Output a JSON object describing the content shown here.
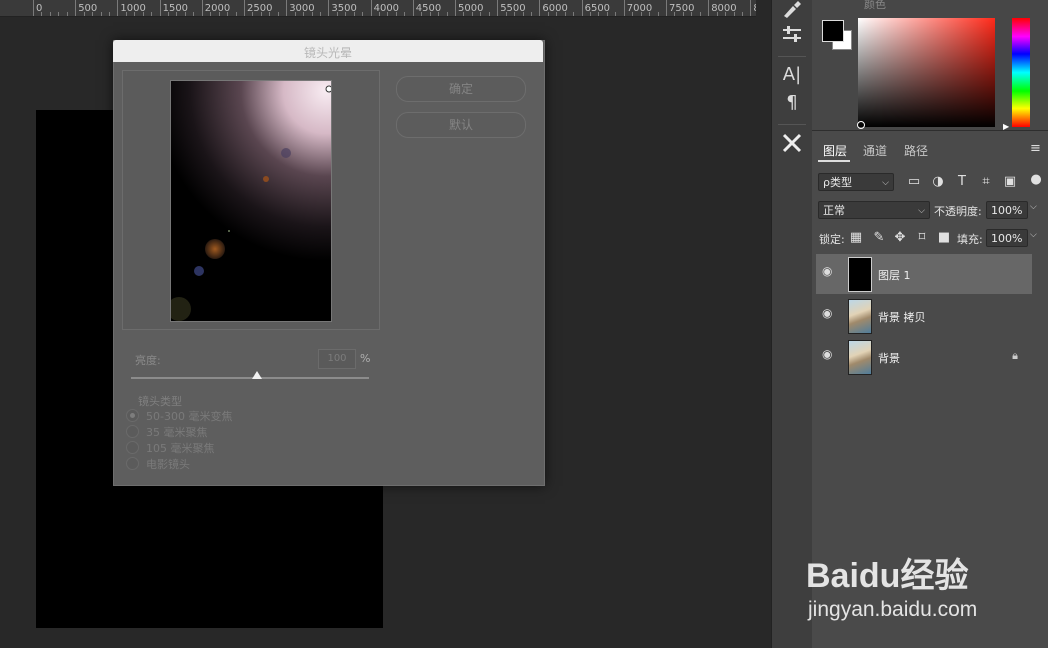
{
  "ruler": {
    "labels": [
      "0",
      "500",
      "1000",
      "1500",
      "2000",
      "2500",
      "3000",
      "3500",
      "4000",
      "4500",
      "5000",
      "5500",
      "6000",
      "6500",
      "7000",
      "7500",
      "8000",
      "8"
    ]
  },
  "toolbar": {
    "icons": [
      "brush-settings-icon",
      "adjust-sliders-icon",
      "character-icon",
      "paragraph-icon",
      "tools-icon"
    ],
    "character_glyph": "A|",
    "paragraph_glyph": "¶"
  },
  "color_panel": {
    "title": "颜色",
    "foreground": "#000000",
    "background": "#ffffff",
    "hue": "#ff2a1a"
  },
  "layers_panel": {
    "tabs": [
      "图层",
      "通道",
      "路径"
    ],
    "filter_label": "ρ类型",
    "blend_mode": "正常",
    "opacity_label": "不透明度:",
    "opacity_value": "100%",
    "lock_label": "锁定:",
    "fill_label": "填充:",
    "fill_value": "100%",
    "layers": [
      {
        "name": "图层 1",
        "thumb": "black",
        "active": true,
        "locked": false
      },
      {
        "name": "背景 拷贝",
        "thumb": "photo",
        "active": false,
        "locked": false
      },
      {
        "name": "背景",
        "thumb": "photo",
        "active": false,
        "locked": true
      }
    ]
  },
  "dialog": {
    "title": "镜头光晕",
    "ok_label": "确定",
    "reset_label": "默认",
    "brightness_label": "亮度:",
    "brightness_value": "100",
    "brightness_unit": "%",
    "brightness_percent": 53,
    "lens_type_label": "镜头类型",
    "lens_options": [
      "50-300 毫米变焦",
      "35 毫米聚焦",
      "105 毫米聚焦",
      "电影镜头"
    ],
    "selected_lens": 0
  },
  "watermark": {
    "logo": "Baidu经验",
    "url": "jingyan.baidu.com"
  }
}
